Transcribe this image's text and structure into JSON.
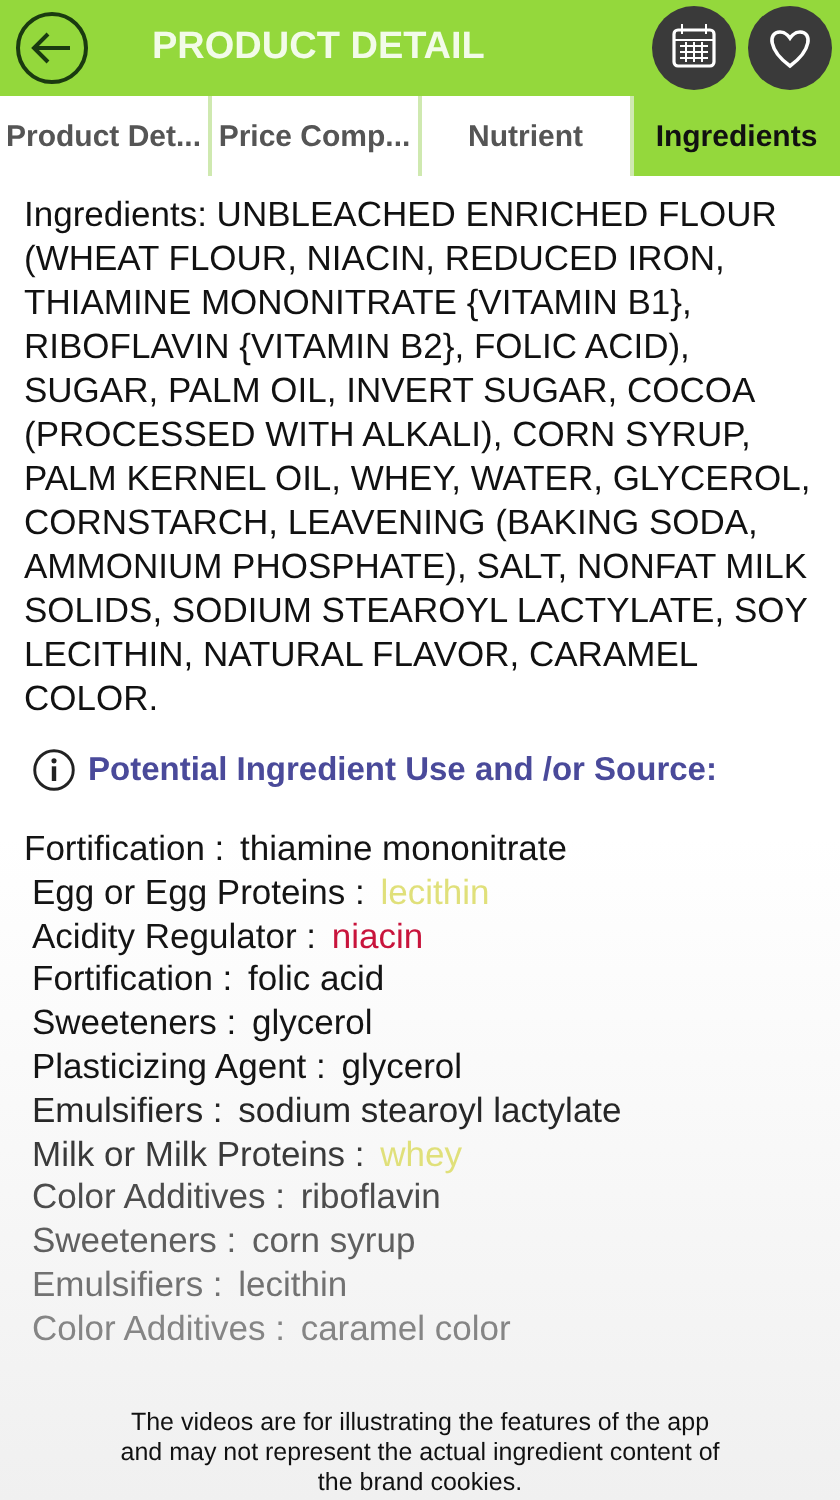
{
  "header": {
    "title": "PRODUCT DETAIL"
  },
  "tabs": [
    {
      "label": "Product Det...",
      "selected": false
    },
    {
      "label": "Price Comp...",
      "selected": false
    },
    {
      "label": "Nutrient",
      "selected": false
    },
    {
      "label": "Ingredients",
      "selected": true
    }
  ],
  "ingredients_text": "Ingredients: UNBLEACHED ENRICHED FLOUR (WHEAT FLOUR, NIACIN, REDUCED IRON, THIAMINE MONONITRATE {VITAMIN B1}, RIBOFLAVIN {VITAMIN B2}, FOLIC ACID), SUGAR, PALM OIL, INVERT SUGAR, COCOA (PROCESSED WITH ALKALI), CORN SYRUP, PALM KERNEL OIL, WHEY, WATER, GLYCEROL, CORNSTARCH, LEAVENING (BAKING SODA, AMMONIUM PHOSPHATE), SALT, NONFAT MILK SOLIDS, SODIUM STEAROYL LACTYLATE, SOY LECITHIN, NATURAL FLAVOR, CARAMEL COLOR.",
  "section_title": "Potential Ingredient Use and /or Source:",
  "uses": [
    {
      "label": "Fortification : ",
      "value": "thiamine mononitrate"
    },
    {
      "label": "Egg or Egg Proteins : ",
      "value": "lecithin",
      "color": "#e0e07a"
    },
    {
      "label": "Acidity Regulator : ",
      "value": "niacin",
      "color": "#c8143c"
    },
    {
      "label": "Fortification : ",
      "value": "folic acid"
    },
    {
      "label": "Sweeteners : ",
      "value": "glycerol"
    },
    {
      "label": "Plasticizing Agent : ",
      "value": "glycerol"
    },
    {
      "label": "Emulsifiers : ",
      "value": "sodium stearoyl lactylate"
    },
    {
      "label": "Milk or Milk Proteins : ",
      "value": "whey",
      "color": "#e0e07a"
    },
    {
      "label": "Color Additives : ",
      "value": "riboflavin"
    },
    {
      "label": "Sweeteners : ",
      "value": "corn syrup"
    },
    {
      "label": "Emulsifiers : ",
      "value": "lecithin"
    },
    {
      "label": "Color Additives : ",
      "value": "caramel color"
    }
  ],
  "disclaimer": "The videos are for illustrating the features of the app and may not represent the actual ingredient content of the brand cookies."
}
